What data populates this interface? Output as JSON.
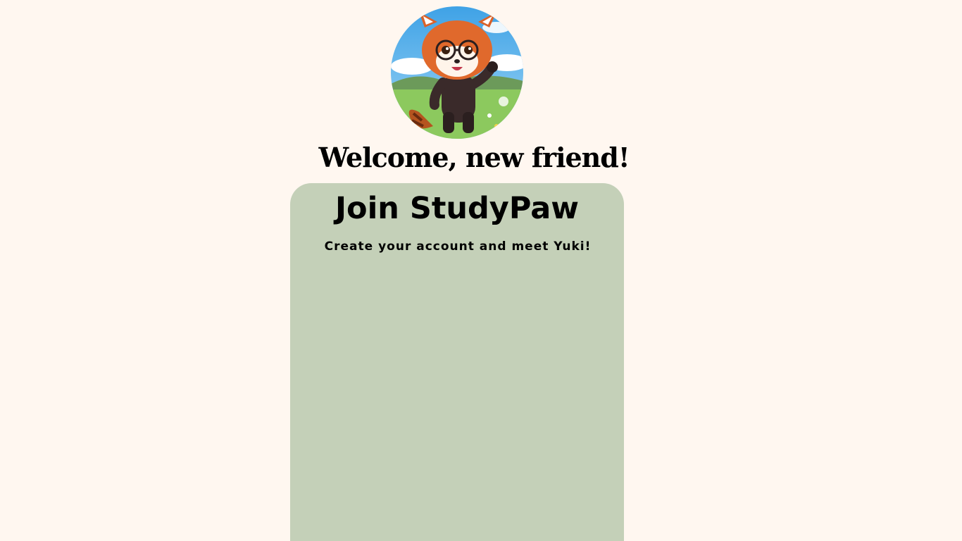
{
  "header": {
    "mascot_alt": "red panda mascot waving",
    "welcome_text": "Welcome, new friend!"
  },
  "card": {
    "title": "Join StudyPaw",
    "subtitle": "Create your account and meet Yuki!"
  },
  "colors": {
    "page_background": "#fff7f0",
    "card_background": "#c4d0b8",
    "text": "#000000"
  }
}
